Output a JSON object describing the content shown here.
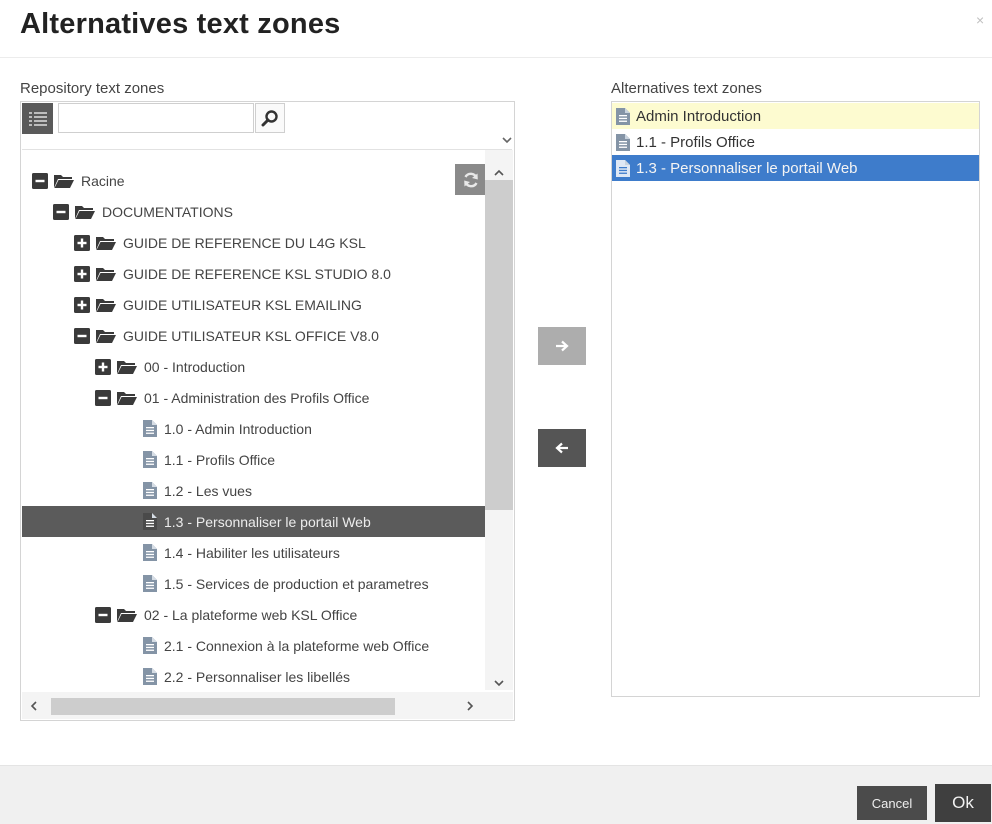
{
  "dialog": {
    "title": "Alternatives text zones",
    "close": "×"
  },
  "left_panel": {
    "label": "Repository text zones",
    "search": {
      "value": "",
      "placeholder": ""
    },
    "tree": [
      {
        "label": "Racine",
        "type": "folder",
        "toggle": "minus",
        "selected": false
      },
      {
        "label": "DOCUMENTATIONS",
        "type": "folder",
        "toggle": "minus",
        "selected": false
      },
      {
        "label": "GUIDE DE REFERENCE DU L4G KSL",
        "type": "folder",
        "toggle": "plus",
        "selected": false
      },
      {
        "label": "GUIDE DE REFERENCE KSL STUDIO 8.0",
        "type": "folder",
        "toggle": "plus",
        "selected": false
      },
      {
        "label": "GUIDE UTILISATEUR KSL EMAILING",
        "type": "folder",
        "toggle": "plus",
        "selected": false
      },
      {
        "label": "GUIDE UTILISATEUR KSL OFFICE V8.0",
        "type": "folder",
        "toggle": "minus",
        "selected": false
      },
      {
        "label": "00 - Introduction",
        "type": "folder",
        "toggle": "plus",
        "selected": false
      },
      {
        "label": "01 - Administration des Profils Office",
        "type": "folder",
        "toggle": "minus",
        "selected": false
      },
      {
        "label": "1.0 - Admin Introduction",
        "type": "file",
        "selected": false
      },
      {
        "label": "1.1 - Profils Office",
        "type": "file",
        "selected": false
      },
      {
        "label": "1.2 - Les vues",
        "type": "file",
        "selected": false
      },
      {
        "label": "1.3 - Personnaliser le portail Web",
        "type": "file",
        "selected": true
      },
      {
        "label": "1.4 - Habiliter les utilisateurs",
        "type": "file",
        "selected": false
      },
      {
        "label": "1.5 - Services de production et parametres",
        "type": "file",
        "selected": false
      },
      {
        "label": "02 - La plateforme web KSL Office",
        "type": "folder",
        "toggle": "minus",
        "selected": false
      },
      {
        "label": "2.1 - Connexion à la plateforme web Office",
        "type": "file",
        "selected": false
      },
      {
        "label": "2.2 - Personnaliser les libellés",
        "type": "file",
        "selected": false
      }
    ]
  },
  "right_panel": {
    "label": "Alternatives text zones",
    "items": [
      {
        "label": "Admin Introduction",
        "state": "highlighted"
      },
      {
        "label": "1.1 - Profils Office",
        "state": "normal"
      },
      {
        "label": "1.3 - Personnaliser le portail Web",
        "state": "selected"
      }
    ]
  },
  "footer": {
    "cancel_label": "Cancel",
    "ok_label": "Ok"
  },
  "icons": {
    "menu": "list-icon",
    "search": "magnifier-icon",
    "refresh": "refresh-icon",
    "move_right": "arrow-right-icon",
    "move_left": "arrow-left-icon",
    "folder": "folder-open-icon",
    "file": "document-icon",
    "expand": "plus-square-icon",
    "collapse": "minus-square-icon"
  },
  "colors": {
    "selected_tree_row": "#5b5b5b",
    "selected_alt_row": "#3e7ccb",
    "highlight_alt_row": "#fdfbd0",
    "button_dark": "#4b4b4b"
  }
}
